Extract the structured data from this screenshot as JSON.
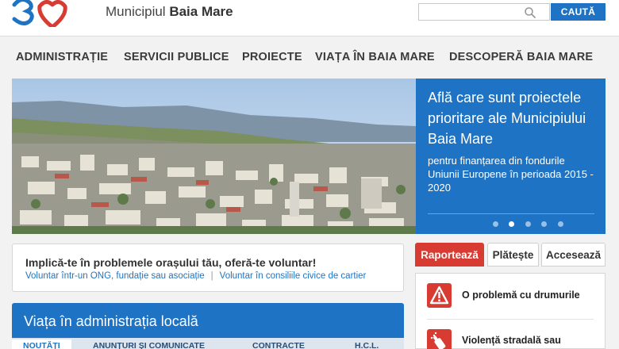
{
  "header": {
    "logo_mark": "3M",
    "site_name_prefix": "Municipiul ",
    "site_name_bold": "Baia Mare",
    "search_placeholder": "",
    "search_button": "CAUTĂ"
  },
  "nav": {
    "items": [
      {
        "label": "ADMINISTRAȚIE"
      },
      {
        "label": "SERVICII PUBLICE"
      },
      {
        "label": "PROIECTE"
      },
      {
        "label": "VIAȚA ÎN BAIA MARE"
      },
      {
        "label": "DESCOPERĂ BAIA MARE"
      }
    ]
  },
  "hero": {
    "title": "Află care sunt proiectele prioritare ale Municipiului Baia Mare",
    "subtitle": "pentru finanțarea din fondurile Uniunii Europene în perioada 2015 - 2020",
    "slide_count": 5,
    "active_slide": 2
  },
  "volunteer": {
    "title": "Implică-te în problemele orașului tău, oferă-te voluntar!",
    "link_1": "Voluntar într-un ONG, fundație sau asociație",
    "separator": "|",
    "link_2": "Voluntar în consiliile civice de cartier"
  },
  "admin": {
    "title": "Viața în administrația locală",
    "tabs": [
      {
        "label": "NOUTĂȚI"
      },
      {
        "label": "ANUNȚURI ȘI COMUNICATE"
      },
      {
        "label": "CONTRACTE"
      },
      {
        "label": "H.C.L."
      }
    ]
  },
  "actions": {
    "tabs": [
      {
        "label": "Raportează"
      },
      {
        "label": "Plătește"
      },
      {
        "label": "Accesează"
      }
    ],
    "reports": [
      {
        "label": "O problemă cu drumurile",
        "icon": "warning-triangle-icon"
      },
      {
        "label": "Violență stradală sau",
        "icon": "spray-can-icon"
      }
    ]
  },
  "colors": {
    "brand_blue": "#1f73c4",
    "accent_red": "#d73b32"
  }
}
